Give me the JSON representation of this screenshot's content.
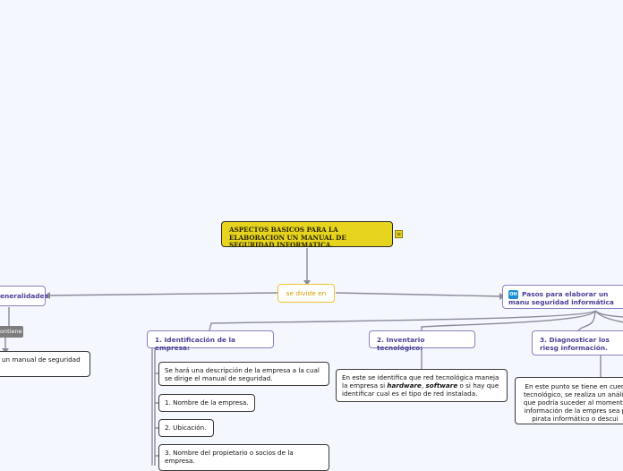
{
  "root": {
    "label": "ASPECTOS BASICOS PARA LA ELABORACION UN MANUAL DE SEGURIDAD INFORMATICA."
  },
  "connector": {
    "label": "se divide en"
  },
  "left_topic": {
    "label": "eneralidades"
  },
  "left_tag": {
    "label": "ontiene"
  },
  "left_note": {
    "text": "un manual de seguridad"
  },
  "right_topic": {
    "badge": "OH",
    "label": "Pasos para elaborar un manu seguridad informática"
  },
  "steps": [
    {
      "label": "1. Identificación de la empresa:"
    },
    {
      "label": "2. Inventario tecnológico:"
    },
    {
      "label": "3. Diagnosticar los riesg información."
    }
  ],
  "step1_items": [
    "Se hará una descripción de la empresa a la cual se dirige el manual de seguridad.",
    "1. Nombre de la empresa.",
    "2. Ubicación.",
    "3. Nombre del propietario o socios de la empresa."
  ],
  "step2_detail": {
    "pre": "En este se identifica que red tecnológica maneja la empresa si ",
    "hardware": "hardware",
    "sep": ", ",
    "software": "software",
    "post": " o si hay que identificar cual es el tipo de red instalada."
  },
  "step3_detail": "En este punto se tiene en cuen tecnológico, se realiza un anális que podría suceder al momento información de la empres sea p pirata informático o descui",
  "colors": {
    "root": "#e6d41f",
    "connector": "#f1c232",
    "topic": "#8a7fc2",
    "line": "#8a8a9a",
    "badge": "#1a8fd6"
  }
}
